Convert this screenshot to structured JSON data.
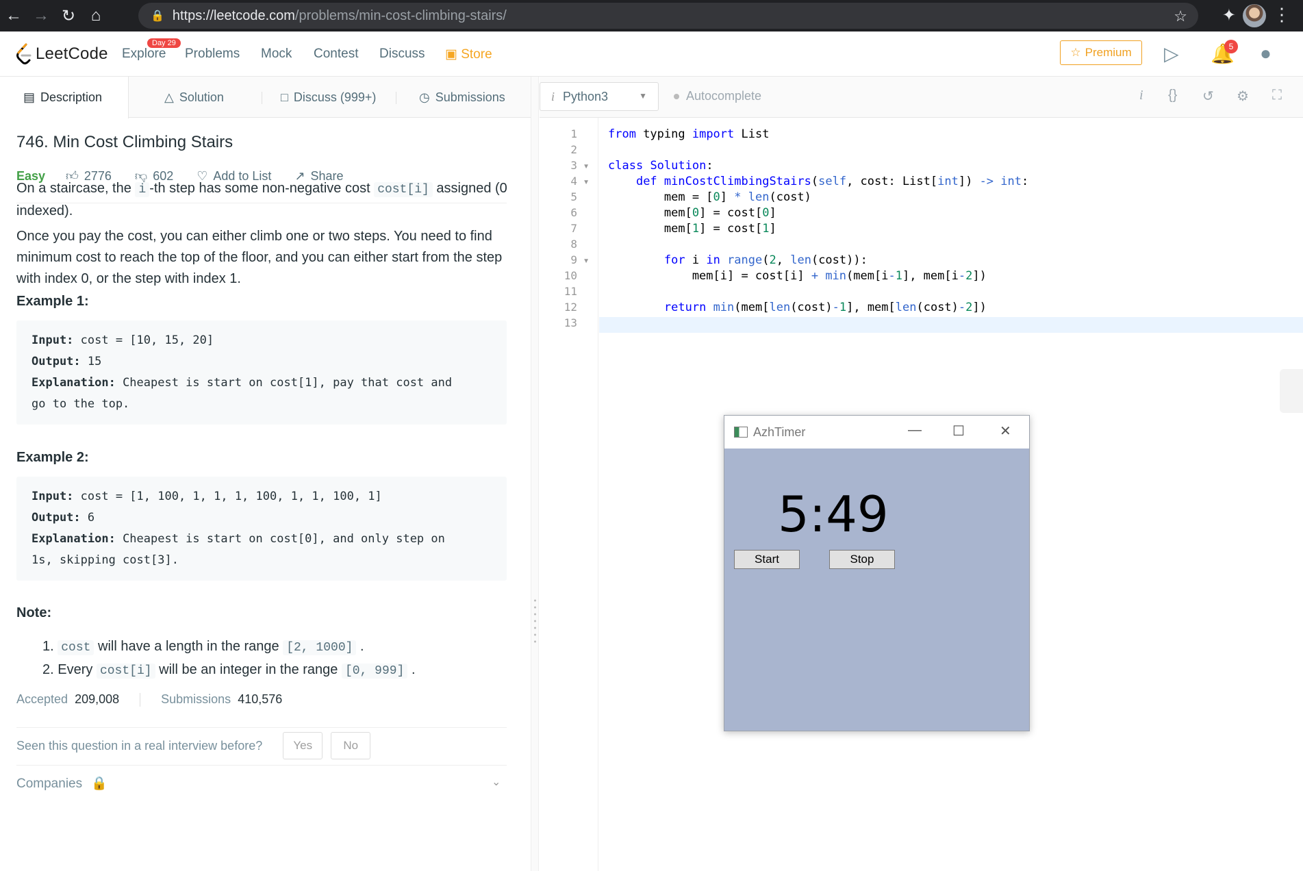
{
  "browser": {
    "url_host": "https://leetcode.com",
    "url_path": "/problems/min-cost-climbing-stairs/"
  },
  "nav": {
    "logo": "LeetCode",
    "day_badge": "Day 29",
    "explore": "Explore",
    "problems": "Problems",
    "mock": "Mock",
    "contest": "Contest",
    "discuss": "Discuss",
    "store": "Store",
    "premium": "Premium",
    "notif_count": "5"
  },
  "tabs": {
    "description": "Description",
    "solution": "Solution",
    "discuss": "Discuss (999+)",
    "submissions": "Submissions"
  },
  "problem": {
    "title": "746. Min Cost Climbing Stairs",
    "difficulty": "Easy",
    "likes": "2776",
    "dislikes": "602",
    "add_to_list": "Add to List",
    "share": "Share",
    "p1a": "On a staircase, the ",
    "p1_code1": "i",
    "p1b": "-th step has some non-negative cost ",
    "p1_code2": "cost[i]",
    "p1c": " assigned (0 indexed).",
    "p2": "Once you pay the cost, you can either climb one or two steps. You need to find minimum cost to reach the top of the floor, and you can either start from the step with index 0, or the step with index 1.",
    "example1_title": "Example 1:",
    "example1": {
      "input_label": "Input:",
      "input": " cost = [10, 15, 20]",
      "output_label": "Output:",
      "output": " 15",
      "expl_label": "Explanation:",
      "expl1": " Cheapest is start on cost[1], pay that cost and",
      "expl2": "go to the top."
    },
    "example2_title": "Example 2:",
    "example2": {
      "input_label": "Input:",
      "input": " cost = [1, 100, 1, 1, 1, 100, 1, 1, 100, 1]",
      "output_label": "Output:",
      "output": " 6",
      "expl_label": "Explanation:",
      "expl1": " Cheapest is start on cost[0], and only step on",
      "expl2": "1s, skipping cost[3]."
    },
    "note_title": "Note:",
    "note1_num": "1.",
    "note1_code": "cost",
    "note1_text": " will have a length in the range ",
    "note1_range": "[2, 1000]",
    "note2_num": "2.",
    "note2_text1": "Every ",
    "note2_code": "cost[i]",
    "note2_text2": " will be an integer in the range ",
    "note2_range": "[0, 999]",
    "accepted_label": "Accepted",
    "accepted": "209,008",
    "submissions_label": "Submissions",
    "submissions": "410,576",
    "interview_q": "Seen this question in a real interview before?",
    "yes": "Yes",
    "no": "No",
    "companies": "Companies"
  },
  "editor": {
    "language": "Python3",
    "autocomplete": "Autocomplete",
    "line_numbers": [
      "1",
      "2",
      "3",
      "4",
      "5",
      "6",
      "7",
      "8",
      "9",
      "10",
      "11",
      "12",
      "13"
    ]
  },
  "timer": {
    "title": "AzhTimer",
    "time": "5:49",
    "start": "Start",
    "stop": "Stop"
  }
}
